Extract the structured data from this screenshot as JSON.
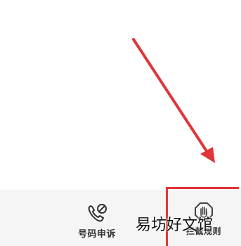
{
  "bottom_bar": {
    "items": [
      {
        "label": "号码申诉",
        "icon": "phone-blocked-icon"
      },
      {
        "label": "拦截规则",
        "icon": "hand-stop-icon"
      }
    ]
  },
  "annotation": {
    "arrow_color": "#e0353b",
    "highlight_color": "#e0353b"
  },
  "watermark": {
    "text": "易坊好文馆"
  }
}
